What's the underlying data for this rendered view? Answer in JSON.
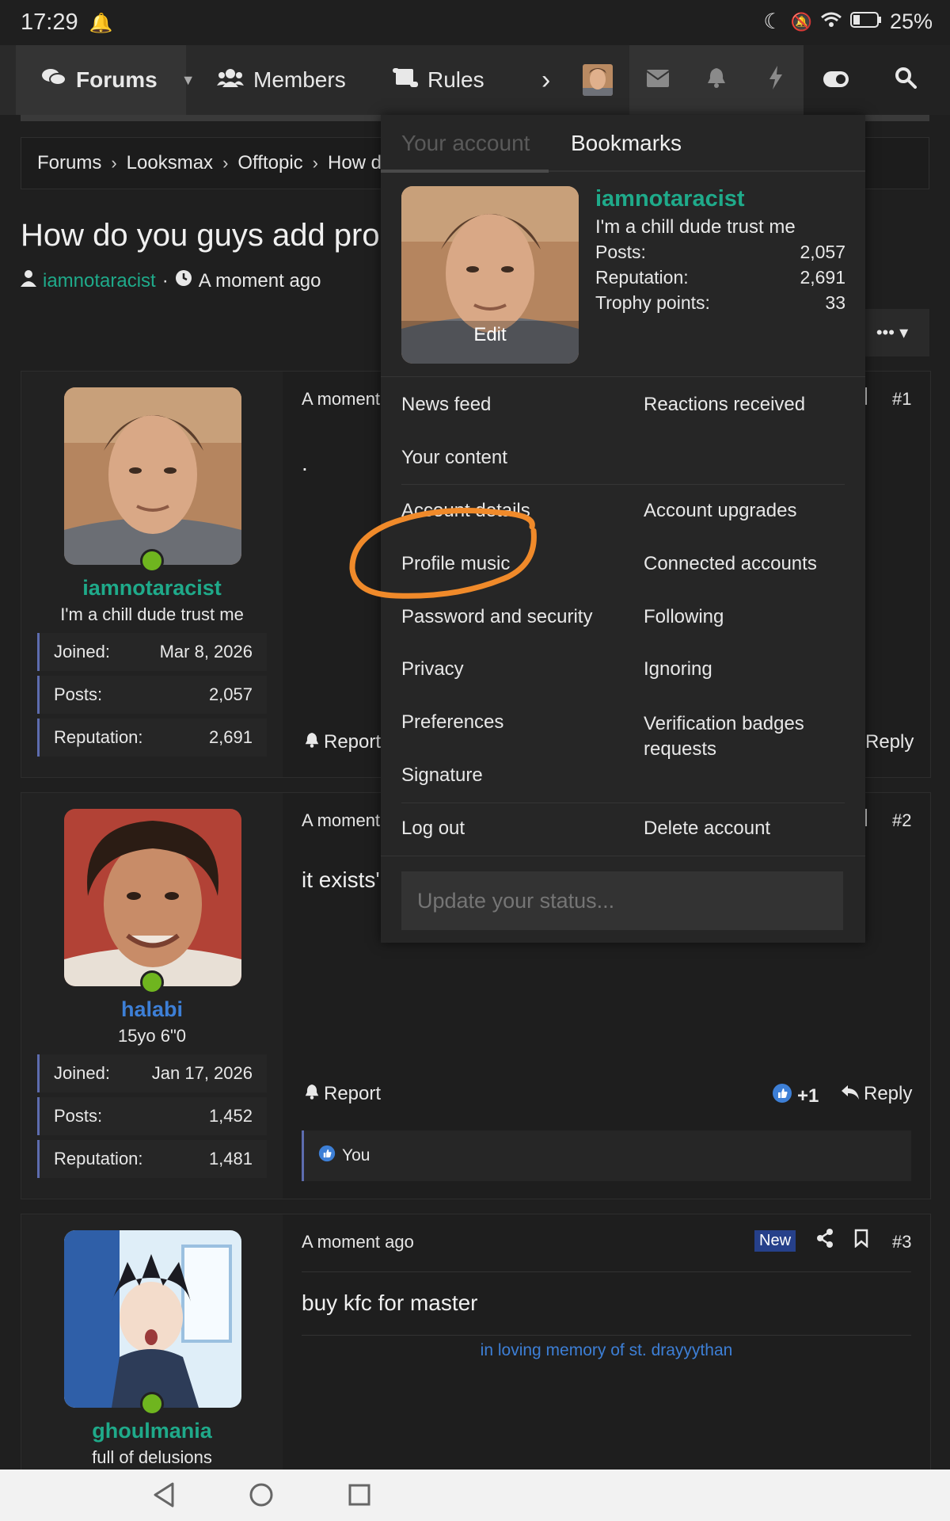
{
  "status_bar": {
    "time": "17:29",
    "battery": "25%"
  },
  "nav": {
    "forums": "Forums",
    "members": "Members",
    "rules": "Rules"
  },
  "breadcrumb": [
    "Forums",
    "Looksmax",
    "Offtopic",
    "How d"
  ],
  "thread": {
    "title": "How do you guys add pro",
    "author": "iamnotaracist",
    "time": "A moment ago"
  },
  "posts": [
    {
      "username": "iamnotaracist",
      "user_title": "I'm a chill dude trust me",
      "joined_label": "Joined:",
      "joined": "Mar 8, 2026",
      "posts_label": "Posts:",
      "posts": "2,057",
      "reputation_label": "Reputation:",
      "reputation": "2,691",
      "time": "A moment",
      "number": "#1",
      "body": ".",
      "report": "Report",
      "reply": "Reply"
    },
    {
      "username": "halabi",
      "user_title": "15yo 6\"0",
      "joined_label": "Joined:",
      "joined": "Jan 17, 2026",
      "posts_label": "Posts:",
      "posts": "1,452",
      "reputation_label": "Reputation:",
      "reputation": "1,481",
      "time": "A moment",
      "number": "#2",
      "body": "it exists'",
      "report": "Report",
      "reaction_count": "+1",
      "reply": "Reply",
      "reacted_by": "You"
    },
    {
      "username": "ghoulmania",
      "user_title": "full of delusions",
      "time": "A moment ago",
      "badge": "New",
      "number": "#3",
      "body": "buy kfc for master",
      "signature": "in loving memory of st. drayyythan"
    }
  ],
  "account_menu": {
    "tab_account": "Your account",
    "tab_bookmarks": "Bookmarks",
    "username": "iamnotaracist",
    "user_title": "I'm a chill dude trust me",
    "stats": [
      {
        "label": "Posts:",
        "value": "2,057"
      },
      {
        "label": "Reputation:",
        "value": "2,691"
      },
      {
        "label": "Trophy points:",
        "value": "33"
      }
    ],
    "edit": "Edit",
    "links_left": [
      "News feed",
      "Your content",
      "Account details",
      "Profile music",
      "Password and security",
      "Privacy",
      "Preferences",
      "Signature",
      "Log out"
    ],
    "links_right": [
      "Reactions received",
      "Account upgrades",
      "Connected accounts",
      "Following",
      "Ignoring",
      "Verification badges requests",
      "Delete account"
    ],
    "status_placeholder": "Update your status..."
  },
  "colors": {
    "accent": "#1faa8a",
    "link_blue": "#3d7fd6",
    "annotation": "#f08a2a",
    "online": "#6fb51f"
  }
}
